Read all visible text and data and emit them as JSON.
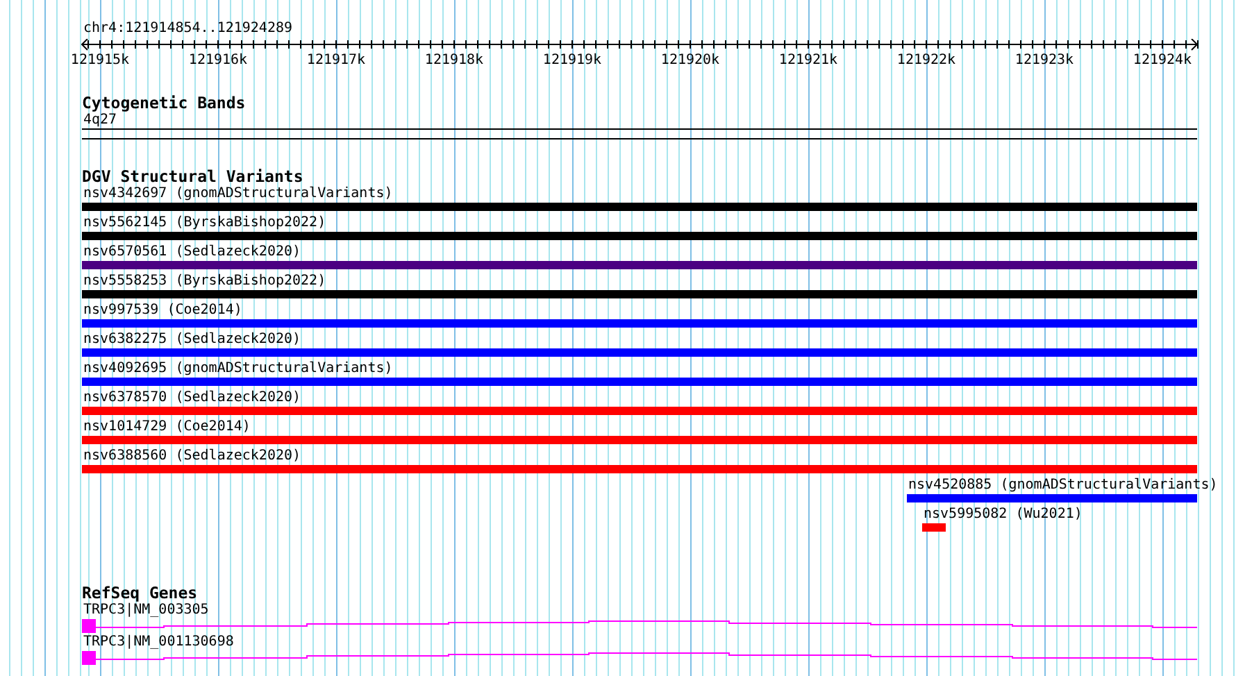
{
  "ruler": {
    "location": "chr4:121914854..121924289",
    "ticks": [
      "121915k",
      "121916k",
      "121917k",
      "121918k",
      "121919k",
      "121920k",
      "121921k",
      "121922k",
      "121923k",
      "121924k"
    ]
  },
  "tracks": [
    {
      "kind": "bands",
      "title": "Cytogenetic Bands",
      "bands": [
        {
          "label": "4q27"
        }
      ]
    },
    {
      "kind": "variants",
      "title": "DGV Structural Variants",
      "features": [
        {
          "label": "nsv4342697 (gnomADStructuralVariants)",
          "color": "#000000",
          "kind": "full"
        },
        {
          "label": "nsv5562145 (ByrskaBishop2022)",
          "color": "#000000",
          "kind": "full"
        },
        {
          "label": "nsv6570561 (Sedlazeck2020)",
          "color": "#4b0082",
          "kind": "full"
        },
        {
          "label": "nsv5558253 (ByrskaBishop2022)",
          "color": "#000000",
          "kind": "full"
        },
        {
          "label": "nsv997539 (Coe2014)",
          "color": "#0000ff",
          "kind": "full"
        },
        {
          "label": "nsv6382275 (Sedlazeck2020)",
          "color": "#0000ff",
          "kind": "full"
        },
        {
          "label": "nsv4092695 (gnomADStructuralVariants)",
          "color": "#0000ff",
          "kind": "full"
        },
        {
          "label": "nsv6378570 (Sedlazeck2020)",
          "color": "#ff0000",
          "kind": "full"
        },
        {
          "label": "nsv1014729 (Coe2014)",
          "color": "#ff0000",
          "kind": "full"
        },
        {
          "label": "nsv6388560 (Sedlazeck2020)",
          "color": "#ff0000",
          "kind": "full"
        },
        {
          "label": "nsv4520885 (gnomADStructuralVariants)",
          "color": "#0000ff",
          "kind": "tail"
        },
        {
          "label": "nsv5995082 (Wu2021)",
          "color": "#ff0000",
          "kind": "short"
        }
      ]
    },
    {
      "kind": "genes",
      "title": "RefSeq Genes",
      "genes": [
        {
          "label": "TRPC3|NM_003305"
        },
        {
          "label": "TRPC3|NM_001130698"
        }
      ]
    }
  ]
}
